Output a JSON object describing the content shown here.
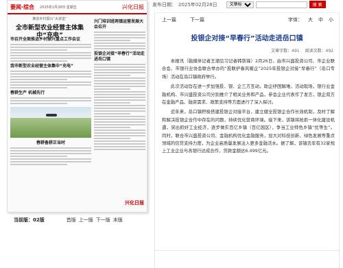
{
  "toolbar": {
    "pub_label": "发布日期：",
    "pub_date": "2025年02月28日",
    "search_type": "文章标题",
    "search_placeholder": "",
    "search_button": "搜 索"
  },
  "paper": {
    "section": "要闻·综合",
    "date_line": "2025年2月28日 星期五",
    "brand": "兴化日报",
    "lead_headline": "全市新型农业经营主体集中“充电”",
    "kicker": "推进乡村振兴“大讲堂”",
    "right_head_1": "兴门培训班两镇运营发展大会召开",
    "right_head_2": "投银企对接“早春行”活动走进岳口镇",
    "left_heads": [
      "市召开全面推进乡村振兴重点工作会议",
      "我市新型农业经营主体集中“充电”",
      "春耕生产 机械先行"
    ],
    "photo_caption": "春耕备耕正当时",
    "corner_logo": "兴化日报"
  },
  "pager": {
    "current_label": "当前版：02版",
    "first": "首版",
    "prev": "上一版",
    "next": "下一版",
    "last": "末版"
  },
  "article": {
    "prev": "上一篇",
    "next": "下一篇",
    "font_label": "字体：",
    "font_large": "大",
    "font_medium": "中",
    "font_small": "小",
    "title": "投银企对接“早春行”活动走进岳口镇",
    "word_count": "文章字数：491",
    "views": "阅读次数：492",
    "paragraphs": [
      "本报讯（融媒体记者王潮见习记者韩铁锋）2月26日，由市兴盛投资公司、市企业联合会、市银行业协会联合举办的“投联护春风暖企”2025年投银企对接“早春行”（岳口专场）活动在岳口镇政府举行。",
      "此次活动旨在进一步加强投、银、企三方互动，助企纾困解难。活动现场，银行业金融机构、市兴盛投资公司分别推介了相关业务和产品，参会企业代表作了发言，银企双方在金融产品、融资需求、政策支持等方面进行了深入探讨。",
      "近年来，岳口镇积极搭建投银企对接平台，建立健全投银企合作长效机制，及时了解和解决投银企合作中存在的问题，持续优化营商环境。接下来，该镇将抢抓一体化建设机遇，突出抓好工业经济，逐步做实百亿乡镇（百亿园区），争当工业特色乡镇“优等生”。同时，联合市兴盛投资公司、金融机构优化金融服务，加大对科技创新、绿色发展等重点领域的信贷支持力度，为企业高质量发展注入更多金融活水。据了解，该镇去年有32家规上工业企业与各银行达成合作，贷款金额达6.499亿元。"
    ]
  }
}
